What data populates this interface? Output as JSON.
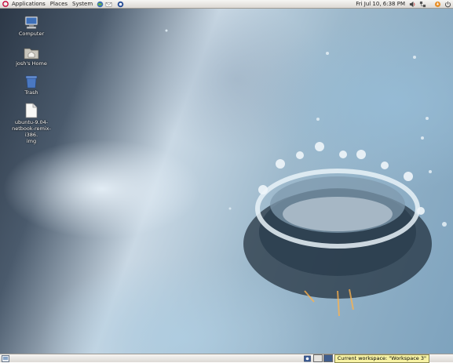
{
  "top_panel": {
    "menus": [
      "Applications",
      "Places",
      "System"
    ],
    "clock": "Fri Jul 10,  6:38 PM"
  },
  "desktop_icons": [
    {
      "label": "Computer",
      "icon": "computer-icon"
    },
    {
      "label": "josh's Home",
      "icon": "home-folder-icon"
    },
    {
      "label": "Trash",
      "icon": "trash-icon"
    },
    {
      "label": "ubuntu-9.04-netbook-remix-i386.img",
      "label_lines": [
        "ubuntu-9.04-",
        "netbook-remix-i386.",
        "img"
      ],
      "icon": "file-icon"
    }
  ],
  "bottom_panel": {
    "tooltip": "Current workspace: \"Workspace 3\"",
    "workspace_count": 2,
    "active_workspace": 1
  },
  "colors": {
    "panel": "#dcd9d4",
    "tooltip_bg": "#f7f2a4",
    "active_workspace": "#3f5d8c"
  }
}
